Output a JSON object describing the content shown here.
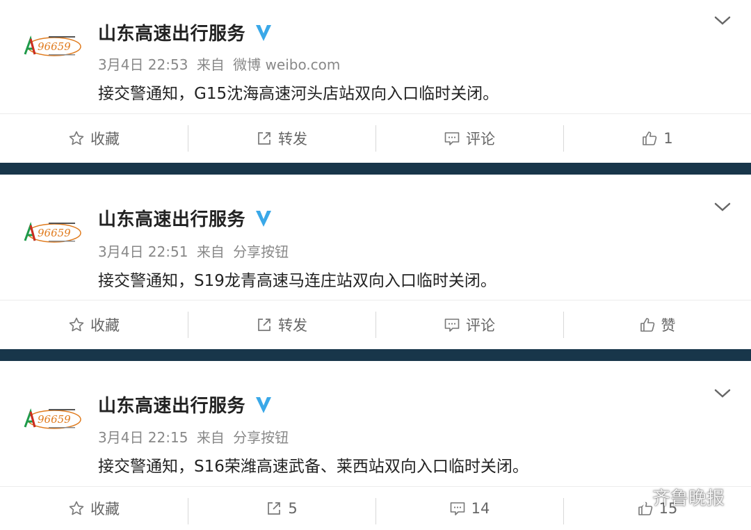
{
  "colors": {
    "verified": "#3aa8e8",
    "separator": "#18364a",
    "text_primary": "#222222",
    "text_secondary": "#888888",
    "logo_orange": "#e07a1c",
    "logo_green": "#1f9a4a"
  },
  "posts": [
    {
      "avatar_text": "96659",
      "username": "山东高速出行服务",
      "time": "3月4日 22:53",
      "source_prefix": "来自",
      "source": "微博 weibo.com",
      "content": "接交警通知，G15沈海高速河头店站双向入口临时关闭。",
      "actions": {
        "favorite": "收藏",
        "repost": "转发",
        "comment": "评论",
        "like": "1"
      }
    },
    {
      "avatar_text": "96659",
      "username": "山东高速出行服务",
      "time": "3月4日 22:51",
      "source_prefix": "来自",
      "source": "分享按钮",
      "content": "接交警通知，S19龙青高速马连庄站双向入口临时关闭。",
      "actions": {
        "favorite": "收藏",
        "repost": "转发",
        "comment": "评论",
        "like": "赞"
      }
    },
    {
      "avatar_text": "96659",
      "username": "山东高速出行服务",
      "time": "3月4日 22:15",
      "source_prefix": "来自",
      "source": "分享按钮",
      "content": "接交警通知，S16荣潍高速武备、莱西站双向入口临时关闭。",
      "actions": {
        "favorite": "收藏",
        "repost": "5",
        "comment": "14",
        "like": "15"
      }
    }
  ],
  "watermark": {
    "text": "齐鲁晚报"
  }
}
